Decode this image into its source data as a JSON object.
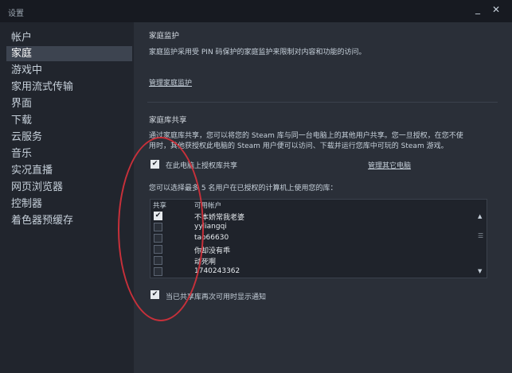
{
  "window": {
    "title": "设置",
    "minimize_glyph": "_",
    "close_glyph": "✕"
  },
  "sidebar": {
    "items": [
      {
        "label": "帐户"
      },
      {
        "label": "家庭",
        "active": true
      },
      {
        "label": "游戏中"
      },
      {
        "label": "家用流式传输"
      },
      {
        "label": "界面"
      },
      {
        "label": "下载"
      },
      {
        "label": "云服务"
      },
      {
        "label": "音乐"
      },
      {
        "label": "实况直播"
      },
      {
        "label": "网页浏览器"
      },
      {
        "label": "控制器"
      },
      {
        "label": "着色器预缓存"
      }
    ]
  },
  "family_view": {
    "heading": "家庭监护",
    "description": "家庭监护采用受 PIN 码保护的家庭监护来限制对内容和功能的访问。",
    "manage_link": "管理家庭监护"
  },
  "library_sharing": {
    "heading": "家庭库共享",
    "description_line1": "通过家庭库共享，您可以将您的 Steam 库与同一台电脑上的其他用户共享。您一旦授权，在您不使",
    "description_line2": "用时，其他获授权此电脑的 Steam 用户便可以访问、下载并运行您库中可玩的 Steam 游戏。",
    "authorize_label": "在此电脑上授权库共享",
    "authorize_checked": true,
    "manage_other_link": "管理其它电脑",
    "choose_users_text": "您可以选择最多 5 名用户在已授权的计算机上使用您的库：",
    "table": {
      "col_share": "共享",
      "col_accounts": "可用帐户",
      "rows": [
        {
          "name": "不本娇常我老婆",
          "checked": true
        },
        {
          "name": "yyliangqi",
          "checked": false
        },
        {
          "name": "tao66630",
          "checked": false
        },
        {
          "name": "你却没有乖",
          "checked": false
        },
        {
          "name": "动死啊",
          "checked": false
        },
        {
          "name": "1740243362",
          "checked": false
        }
      ]
    },
    "notify_label": "当已共享库再次可用时显示通知",
    "notify_checked": true
  },
  "icons": {
    "check": "✔",
    "scroll_up": "▲",
    "scroll_down": "▼",
    "grip": "☰"
  },
  "colors": {
    "annotation_ellipse": "#c7303a",
    "active_nav": "#3d4450"
  }
}
